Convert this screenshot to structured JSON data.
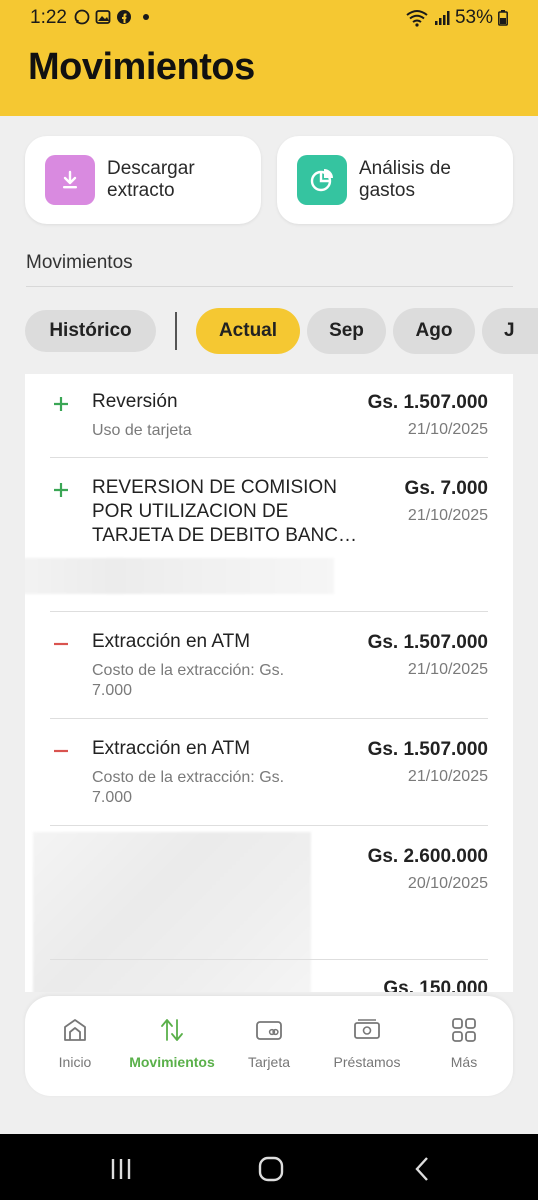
{
  "status_bar": {
    "time": "1:22",
    "battery": "53%"
  },
  "header": {
    "title": "Movimientos"
  },
  "actions": [
    {
      "label": "Descargar extracto",
      "icon": "download-icon",
      "color": "#d98ae0"
    },
    {
      "label": "Análisis de gastos",
      "icon": "pie-chart-icon",
      "color": "#35c4a0"
    }
  ],
  "section": {
    "title": "Movimientos"
  },
  "filters": {
    "history": "Histórico",
    "months": [
      "Actual",
      "Sep",
      "Ago",
      "J"
    ],
    "active": "Actual"
  },
  "transactions": [
    {
      "type": "credit",
      "title": "Reversión",
      "subtitle": "Uso de tarjeta",
      "amount": "Gs. 1.507.000",
      "date": "21/10/2025"
    },
    {
      "type": "credit",
      "title_lines": [
        "REVERSION DE COMISION",
        "POR UTILIZACION DE",
        "TARJETA DE DEBITO BANC…"
      ],
      "amount": "Gs. 7.000",
      "date": "21/10/2025"
    },
    {
      "type": "debit",
      "title": "Extracción en ATM",
      "subtitle_lines": [
        "Costo de la extracción: Gs.",
        "7.000"
      ],
      "amount": "Gs. 1.507.000",
      "date": "21/10/2025"
    },
    {
      "type": "debit",
      "title": "Extracción en ATM",
      "subtitle_lines": [
        "Costo de la extracción: Gs.",
        "7.000"
      ],
      "amount": "Gs. 1.507.000",
      "date": "21/10/2025"
    },
    {
      "type": "unknown",
      "amount": "Gs. 2.600.000",
      "date": "20/10/2025"
    },
    {
      "type": "unknown",
      "amount": "Gs. 150.000"
    }
  ],
  "colors": {
    "brand_yellow": "#f5c832",
    "credit_green": "#3aa655",
    "debit_red": "#d9534f",
    "nav_active": "#5ab04a"
  },
  "bottom_nav": [
    {
      "label": "Inicio",
      "icon": "home-icon"
    },
    {
      "label": "Movimientos",
      "icon": "transfer-arrows-icon",
      "active": true
    },
    {
      "label": "Tarjeta",
      "icon": "card-icon"
    },
    {
      "label": "Préstamos",
      "icon": "cash-icon"
    },
    {
      "label": "Más",
      "icon": "grid-icon"
    }
  ]
}
